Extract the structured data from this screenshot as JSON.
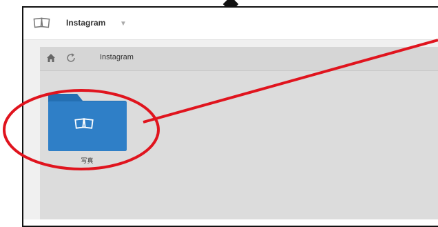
{
  "header": {
    "app_title": "Instagram",
    "app_icon": "photos-icon",
    "dropdown_icon": "caret-down-icon"
  },
  "toolbar": {
    "home_icon": "home-icon",
    "refresh_icon": "refresh-icon",
    "breadcrumb": "Instagram"
  },
  "folders": [
    {
      "label": "写真",
      "icon": "photos-icon"
    }
  ],
  "colors": {
    "folder_blue": "#2f7fc7",
    "folder_tab_blue": "#246fb2",
    "annotation_red": "#e0141e",
    "content_gray": "#dcdcdc"
  }
}
